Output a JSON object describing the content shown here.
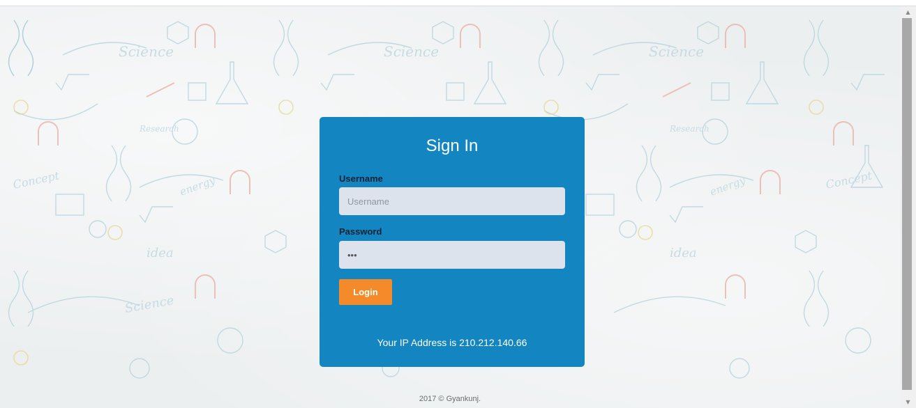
{
  "login": {
    "title": "Sign In",
    "username_label": "Username",
    "username_placeholder": "Username",
    "password_label": "Password",
    "password_value": "***",
    "login_button": "Login",
    "ip_text": "Your IP Address is 210.212.140.66"
  },
  "footer": {
    "text": "2017 © Gyankunj."
  },
  "background": {
    "doodle_words": [
      "Science",
      "Science",
      "Science",
      "Concept",
      "Concept",
      "energy",
      "energy",
      "idea",
      "idea",
      "Science",
      "Research",
      "Research"
    ]
  },
  "colors": {
    "card": "#1386c1",
    "button": "#f58a2a",
    "input_bg": "#dde3ec",
    "page_bg": "#eceff0"
  }
}
